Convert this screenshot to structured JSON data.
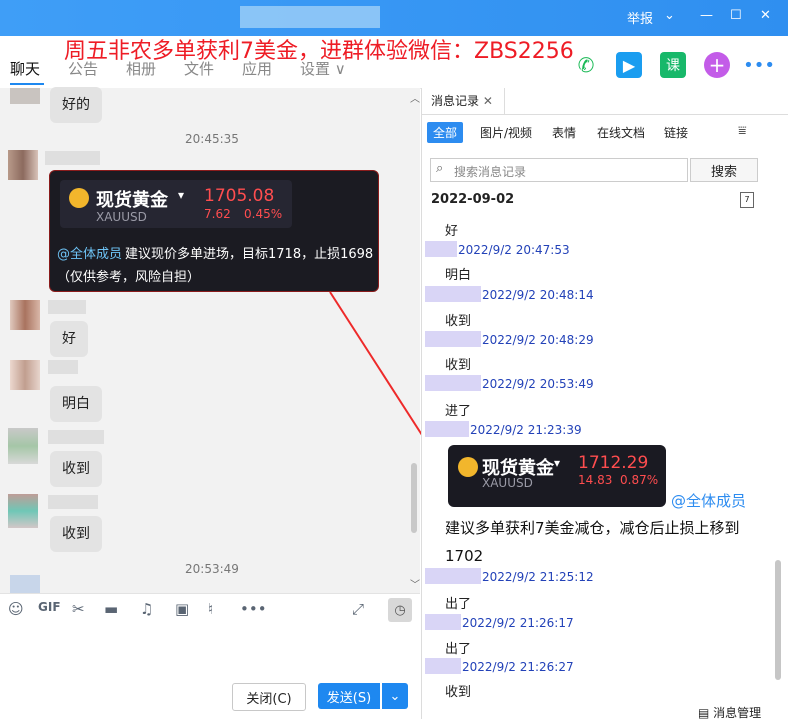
{
  "title_bar": {
    "report": "举报"
  },
  "promo": "周五非农多单获利7美金，进群体验微信：ZBS2256",
  "menu": [
    {
      "label": "聊天",
      "active": true
    },
    {
      "label": "公告"
    },
    {
      "label": "相册"
    },
    {
      "label": "文件"
    },
    {
      "label": "应用"
    },
    {
      "label": "设置 ∨"
    }
  ],
  "top_icons": {
    "course": "课"
  },
  "chat": {
    "msg_ok": "好的",
    "time1": "20:45:35",
    "card1": {
      "name": "现货黄金",
      "symbol": "XAUUSD",
      "price": "1705.08",
      "change": "7.62",
      "percent": "0.45%",
      "mention": "@全体成员",
      "text": "建议现价多单进场，目标1718，止损1698",
      "disclaimer": "（仅供参考，风险自担）"
    },
    "bubbles": [
      "好",
      "明白",
      "收到",
      "收到"
    ],
    "time2": "20:53:49"
  },
  "input": {
    "close_label": "关闭(C)",
    "send_label": "发送(S)"
  },
  "history": {
    "tab_label": "消息记录",
    "filters": [
      "全部",
      "图片/视频",
      "表情",
      "在线文档",
      "链接"
    ],
    "search_placeholder": "搜索消息记录",
    "search_button": "搜索",
    "date": "2022-09-02",
    "entries": [
      {
        "text": "好",
        "time": "2022/9/2 20:47:53"
      },
      {
        "text": "明白",
        "time": "2022/9/2 20:48:14"
      },
      {
        "text": "收到",
        "time": "2022/9/2 20:48:29"
      },
      {
        "text": "收到",
        "time": "2022/9/2 20:53:49"
      },
      {
        "text": "进了",
        "time": "2022/9/2 21:23:39"
      }
    ],
    "card2": {
      "name": "现货黄金",
      "symbol": "XAUUSD",
      "price": "1712.29",
      "change": "14.83",
      "percent": "0.87%",
      "mention": "@全体成员"
    },
    "card2_text": "建议多单获利7美金减仓，减仓后止损上移到1702",
    "entries2": [
      {
        "text": "出了",
        "time": "2022/9/2 21:25:12"
      },
      {
        "text": "出了",
        "time": "2022/9/2 21:26:17"
      },
      {
        "text": "收到",
        "time": "2022/9/2 21:26:27"
      }
    ],
    "manage": "消息管理"
  }
}
